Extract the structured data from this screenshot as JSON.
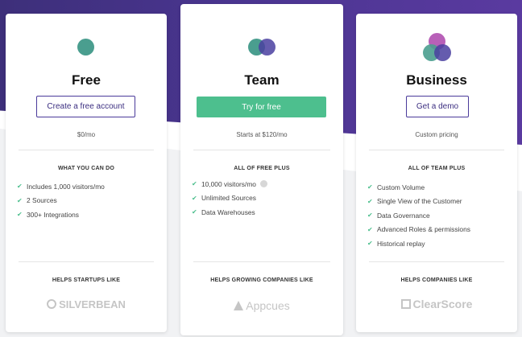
{
  "colors": {
    "teal": "#4a9e8f",
    "indigo": "#4a3fa0",
    "magenta": "#b04fb0",
    "accent_green": "#4dbf8e",
    "purple_bg": "#4a3590"
  },
  "plans": {
    "free": {
      "title": "Free",
      "cta": "Create a free account",
      "price": "$0/mo",
      "features_heading": "WHAT YOU CAN DO",
      "features": [
        "Includes 1,000 visitors/mo",
        "2 Sources",
        "300+ Integrations"
      ],
      "helps_heading": "HELPS STARTUPS LIKE",
      "customer_logo": "SILVERBEAN"
    },
    "team": {
      "title": "Team",
      "cta": "Try for free",
      "price": "Starts at $120/mo",
      "features_heading": "ALL OF FREE PLUS",
      "features": [
        "10,000 visitors/mo",
        "Unlimited Sources",
        "Data Warehouses"
      ],
      "helps_heading": "HELPS GROWING COMPANIES LIKE",
      "customer_logo": "Appcues"
    },
    "business": {
      "title": "Business",
      "cta": "Get a demo",
      "price": "Custom pricing",
      "features_heading": "ALL OF TEAM PLUS",
      "features": [
        "Custom Volume",
        "Single View of the Customer",
        "Data Governance",
        "Advanced Roles & permissions",
        "Historical replay"
      ],
      "helps_heading": "HELPS COMPANIES LIKE",
      "customer_logo": "ClearScore"
    }
  }
}
